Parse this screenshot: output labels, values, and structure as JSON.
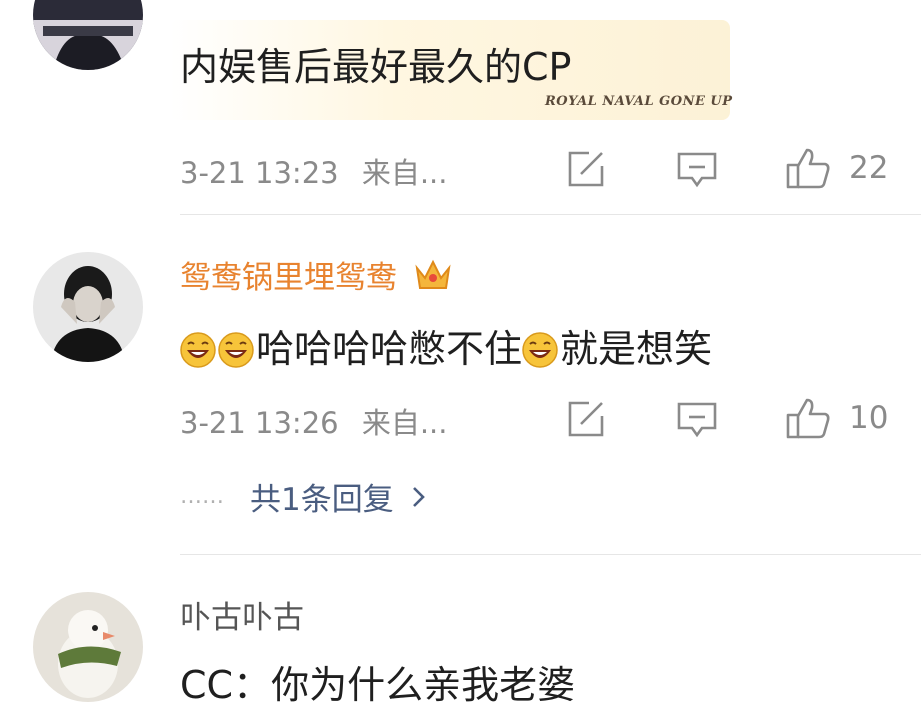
{
  "comments": [
    {
      "username": "",
      "text": "内娱售后最好最久的CP",
      "badge_text": "ROYAL NAVAL GONE UP",
      "timestamp": "3-21 13:23",
      "source": "来自...",
      "likes": "22"
    },
    {
      "username": "鸳鸯锅里埋鸳鸯",
      "text_parts": [
        "哈哈哈哈憋不住",
        "就是想笑"
      ],
      "timestamp": "3-21 13:26",
      "source": "来自...",
      "likes": "10",
      "reply_link": "共1条回复",
      "reply_dots": "……"
    },
    {
      "username": "卟古卟古",
      "text": "CC：你为什么亲我老婆"
    }
  ],
  "colors": {
    "vip_username": "#e8832f",
    "username": "#555555",
    "meta": "#8a8a8a",
    "reply_link": "#4a5d80"
  }
}
